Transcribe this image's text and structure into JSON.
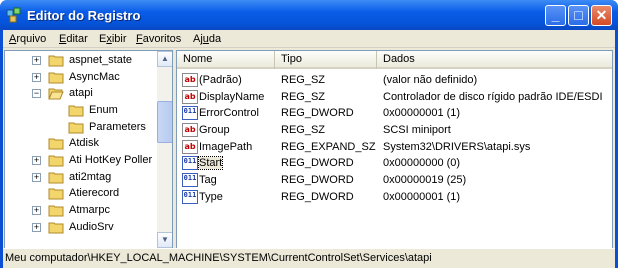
{
  "window": {
    "title": "Editor do Registro",
    "minimize_label": "_",
    "maximize_label": "□",
    "close_label": "✕"
  },
  "menu": [
    {
      "prefix": "",
      "key": "A",
      "rest": "rquivo"
    },
    {
      "prefix": "",
      "key": "E",
      "rest": "ditar"
    },
    {
      "prefix": "E",
      "key": "x",
      "rest": "ibir"
    },
    {
      "prefix": "",
      "key": "F",
      "rest": "avoritos"
    },
    {
      "prefix": "Aj",
      "key": "u",
      "rest": "da"
    }
  ],
  "tree": {
    "items": [
      {
        "label": "aspnet_state",
        "expander": "+"
      },
      {
        "label": "AsyncMac",
        "expander": "+"
      },
      {
        "label": "atapi",
        "expander": "−"
      },
      {
        "label": "Enum",
        "expander": ""
      },
      {
        "label": "Parameters",
        "expander": ""
      },
      {
        "label": "Atdisk",
        "expander": ""
      },
      {
        "label": "Ati HotKey Poller",
        "expander": "+"
      },
      {
        "label": "ati2mtag",
        "expander": "+"
      },
      {
        "label": "Atierecord",
        "expander": ""
      },
      {
        "label": "Atmarpc",
        "expander": "+"
      },
      {
        "label": "AudioSrv",
        "expander": "+"
      }
    ]
  },
  "list": {
    "columns": [
      "Nome",
      "Tipo",
      "Dados"
    ],
    "rows": [
      {
        "icon": "string-value-icon",
        "glyph": "ab",
        "name": "(Padrão)",
        "type": "REG_SZ",
        "data": "(valor não definido)"
      },
      {
        "icon": "string-value-icon",
        "glyph": "ab",
        "name": "DisplayName",
        "type": "REG_SZ",
        "data": "Controlador de disco rígido padrão IDE/ESDI"
      },
      {
        "icon": "dword-value-icon",
        "glyph": "011",
        "name": "ErrorControl",
        "type": "REG_DWORD",
        "data": "0x00000001 (1)"
      },
      {
        "icon": "string-value-icon",
        "glyph": "ab",
        "name": "Group",
        "type": "REG_SZ",
        "data": "SCSI miniport"
      },
      {
        "icon": "string-value-icon",
        "glyph": "ab",
        "name": "ImagePath",
        "type": "REG_EXPAND_SZ",
        "data": "System32\\DRIVERS\\atapi.sys"
      },
      {
        "icon": "dword-value-icon",
        "glyph": "011",
        "name": "Start",
        "type": "REG_DWORD",
        "data": "0x00000000 (0)"
      },
      {
        "icon": "dword-value-icon",
        "glyph": "011",
        "name": "Tag",
        "type": "REG_DWORD",
        "data": "0x00000019 (25)"
      },
      {
        "icon": "dword-value-icon",
        "glyph": "011",
        "name": "Type",
        "type": "REG_DWORD",
        "data": "0x00000001 (1)"
      }
    ]
  },
  "status": {
    "path": "Meu computador\\HKEY_LOCAL_MACHINE\\SYSTEM\\CurrentControlSet\\Services\\atapi"
  }
}
